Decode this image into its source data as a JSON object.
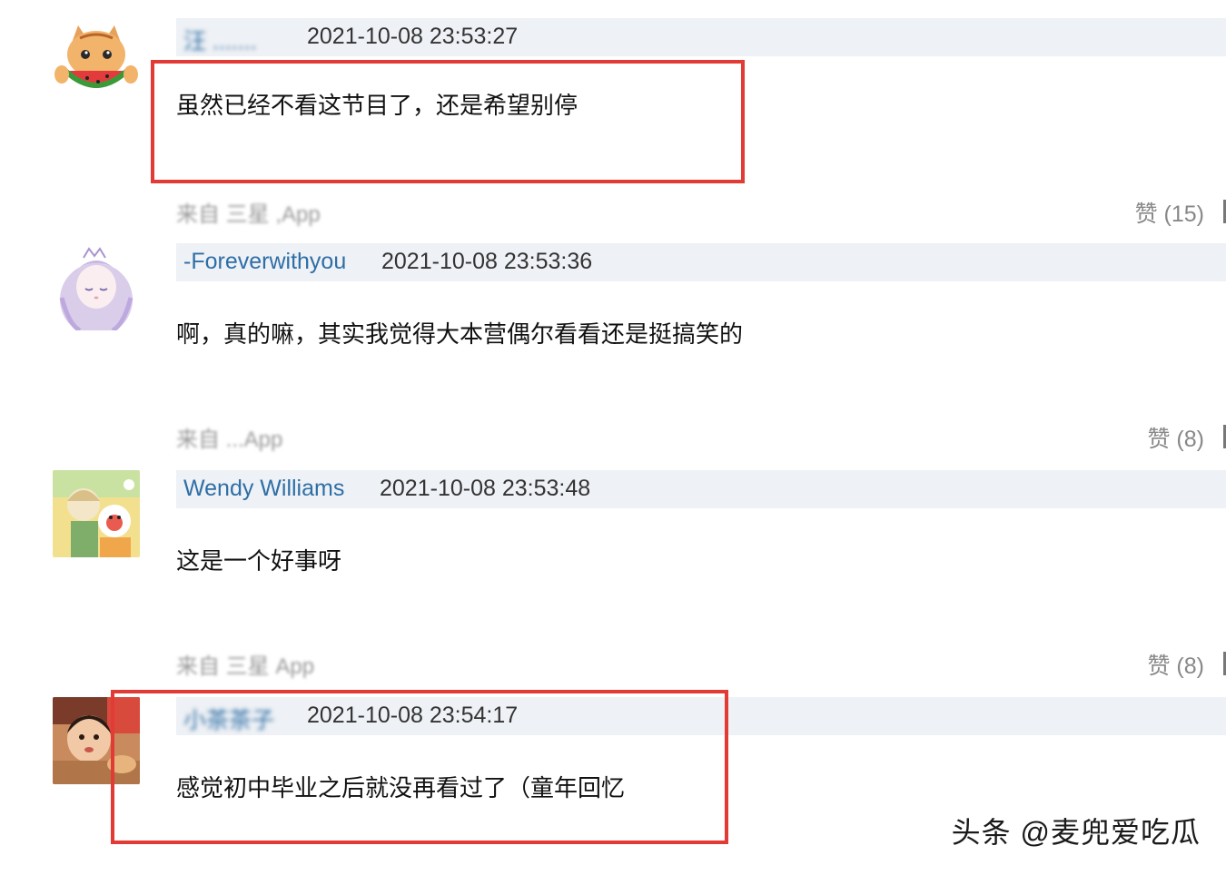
{
  "comments": [
    {
      "username": "汪 .......",
      "timestamp": "2021-10-08 23:53:27",
      "text": "虽然已经不看这节目了，还是希望别停",
      "source": "来自 三星 ,App",
      "likes": "赞 (15)",
      "avatar": "cat-eating-watermelon-avatar"
    },
    {
      "username": "-Foreverwithyou",
      "timestamp": "2021-10-08 23:53:36",
      "text": "啊，真的嘛，其实我觉得大本营偶尔看看还是挺搞笑的",
      "source": "来自 ...App",
      "likes": "赞 (8)",
      "avatar": "anime-girl-avatar"
    },
    {
      "username": "Wendy Williams",
      "timestamp": "2021-10-08 23:53:48",
      "text": "这是一个好事呀",
      "source": "来自 三星 App",
      "likes": "赞 (8)",
      "avatar": "cartoon-avatar"
    },
    {
      "username": "小茶茶子",
      "timestamp": "2021-10-08 23:54:17",
      "text": "感觉初中毕业之后就没再看过了（童年回忆",
      "avatar": "child-photo-avatar"
    }
  ],
  "watermark": "头条 @麦兜爱吃瓜",
  "colors": {
    "highlight": "#e23a35",
    "username": "#2e6ea6",
    "header_bg": "#eef1f5"
  }
}
